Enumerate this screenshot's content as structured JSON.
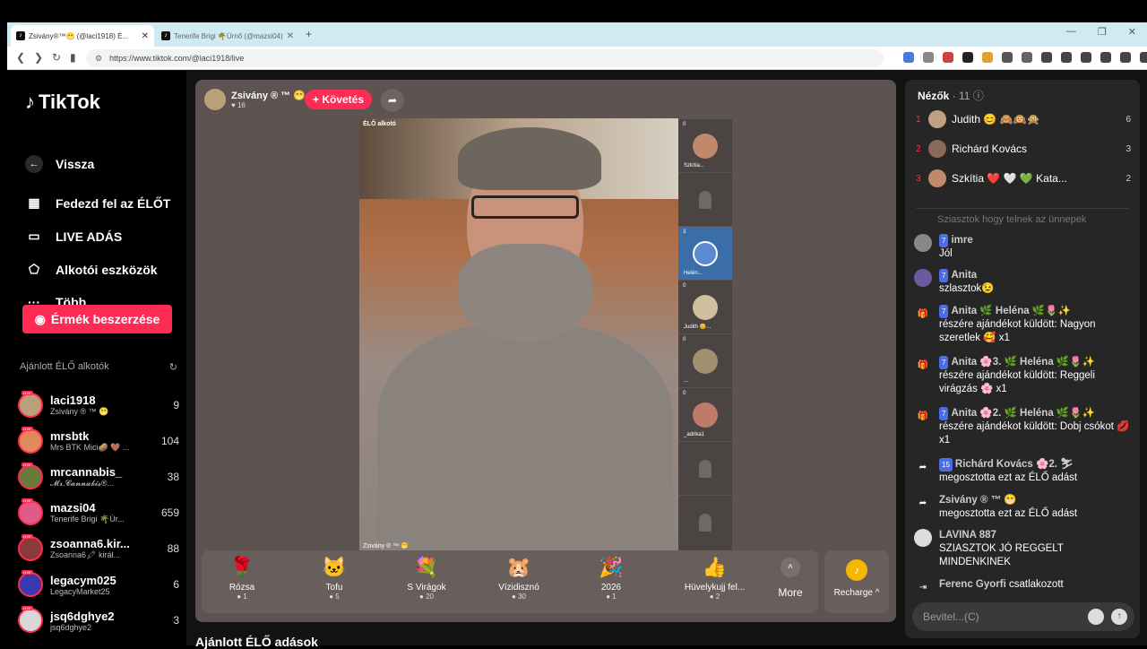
{
  "browser": {
    "tabs": [
      {
        "title": "Zsivány®™😁 (@laci1918) É..."
      },
      {
        "title": "Tenerife Brigi 🌴Úrnő (@mazsi04) É..."
      }
    ],
    "new_tab": "+",
    "url": "https://www.tiktok.com/@laci1918/live"
  },
  "sidebar": {
    "logo": "TikTok",
    "back": "Vissza",
    "nav": [
      {
        "label": "Fedezd fel az ÉLŐT",
        "icon": "calendar-icon"
      },
      {
        "label": "LIVE ADÁS",
        "icon": "video-icon"
      },
      {
        "label": "Alkotói eszközök",
        "icon": "creator-icon"
      },
      {
        "label": "Több",
        "icon": "more-icon"
      }
    ],
    "coins_button": "Érmék beszerzése",
    "recommended_title": "Ajánlott ÉLŐ alkotók",
    "creators": [
      {
        "name": "laci1918",
        "sub": "Zsivány ® ™ 😁",
        "count": "9",
        "color": "#b9a07a"
      },
      {
        "name": "mrsbtk",
        "sub": "Mrs BTK Mici🥔 🤎 ...",
        "count": "104",
        "color": "#e08a5a"
      },
      {
        "name": "mrcannabis_",
        "sub": "𝓜𝓻.𝓒𝓪𝓷𝓷𝓪𝓫𝓲𝓼®...",
        "count": "38",
        "color": "#6a7a3a"
      },
      {
        "name": "mazsi04",
        "sub": "Tenerife Brigi 🌴Úr...",
        "count": "659",
        "color": "#e05a8a"
      },
      {
        "name": "zsoanna6.kir...",
        "sub": "Zsoanna6🖍 királ...",
        "count": "88",
        "color": "#8a3a3a"
      },
      {
        "name": "legacym025",
        "sub": "LegacyMarket25",
        "count": "6",
        "color": "#3a3ab0"
      },
      {
        "name": "jsq6dghye2",
        "sub": "jsq6dghye2",
        "count": "3",
        "color": "#d8d8d8"
      }
    ]
  },
  "live": {
    "host_name": "Zsivány ® ™ 😁",
    "host_likes": "♥ 16",
    "follow": "+ Követés",
    "video_tag": "ÉLŐ alkotó",
    "video_bottom": "Zsivány ® ™ 😁",
    "guests": [
      {
        "count": "0",
        "name": "Szkítia...",
        "color": "#c08a6a"
      },
      {
        "count": "",
        "name": "",
        "color": ""
      },
      {
        "count": "3",
        "name": "Helén...",
        "color": "#5a8ad0"
      },
      {
        "count": "0",
        "name": "Judith 😊...",
        "color": "#d0c0a0"
      },
      {
        "count": "0",
        "name": "...",
        "color": "#a09070"
      },
      {
        "count": "0",
        "name": "_adrika1",
        "color": "#c07a6a"
      },
      {
        "count": "",
        "name": "",
        "color": ""
      },
      {
        "count": "",
        "name": "",
        "color": ""
      }
    ],
    "gifts": [
      {
        "name": "Rózsa",
        "price": "1",
        "icon": "🌹"
      },
      {
        "name": "Tofu",
        "price": "5",
        "icon": "🐱"
      },
      {
        "name": "S Virágok",
        "price": "20",
        "icon": "💐"
      },
      {
        "name": "Vízidisznó",
        "price": "30",
        "icon": "🐹"
      },
      {
        "name": "2026",
        "price": "1",
        "icon": "🎉"
      },
      {
        "name": "Hüvelykujj fel...",
        "price": "2",
        "icon": "👍"
      }
    ],
    "more": "More",
    "recharge": "Recharge ^",
    "below_title": "Ajánlott ÉLŐ adások"
  },
  "chat": {
    "viewers_title": "Nézők",
    "viewers_count": "· 11",
    "viewers": [
      {
        "rank": "1",
        "name": "Judith 😊 🙈🙉🙊",
        "score": "6",
        "color": "#c0a080"
      },
      {
        "rank": "2",
        "name": "Richárd Kovács",
        "score": "3",
        "color": "#8a6a5a"
      },
      {
        "rank": "3",
        "name": "Szkítia ❤️ 🤍 💚 Kata...",
        "score": "2",
        "color": "#c08a6a"
      }
    ],
    "faded": "Sziasztok hogy telnek az ünnepek",
    "messages": [
      {
        "user": "imre",
        "level": "7",
        "text": "Jól",
        "kind": "avatar",
        "color": "#888"
      },
      {
        "user": "Anita",
        "level": "7",
        "text": "szlasztok😉",
        "kind": "avatar",
        "color": "#6a5aa0"
      },
      {
        "user": "Anita 🌿 Heléna 🌿🌷✨",
        "level": "7",
        "text": "részére ajándékot küldött: Nagyon szeretlek 🥰 x1",
        "kind": "gift"
      },
      {
        "user": "Anita 🌸3. 🌿 Heléna 🌿🌷✨",
        "level": "7",
        "text": "részére ajándékot küldött: Reggeli virágzás 🌸 x1",
        "kind": "gift"
      },
      {
        "user": "Anita 🌸2. 🌿 Heléna 🌿🌷✨",
        "level": "7",
        "text": "részére ajándékot küldött: Dobj csókot 💋 x1",
        "kind": "gift"
      },
      {
        "user": "Richárd Kovács 🌸2. ⛷",
        "level": "15",
        "text": "megosztotta ezt az ÉLŐ adást",
        "kind": "share"
      },
      {
        "user": "Zsivány ® ™ 😁",
        "level": "",
        "text": "megosztotta ezt az ÉLŐ adást",
        "kind": "share"
      },
      {
        "user": "LAVINA 887",
        "level": "",
        "text": "SZIASZTOK JÓ REGGELT MINDENKINEK",
        "kind": "avatar",
        "color": "#ddd"
      },
      {
        "user": "Ferenc Gyorfi",
        "level": "",
        "text": "csatlakozott",
        "kind": "join"
      }
    ],
    "input_placeholder": "Bevitel...(C)"
  }
}
